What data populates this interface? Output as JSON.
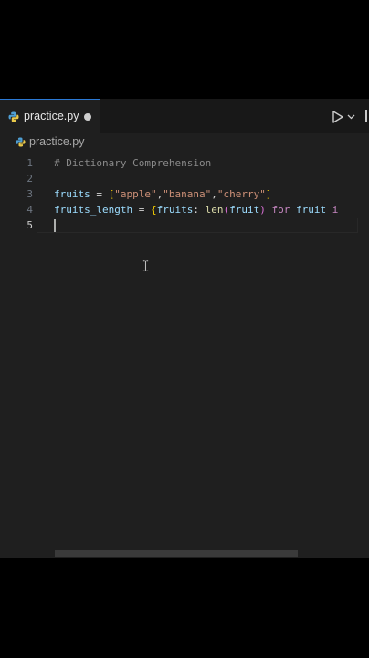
{
  "editor": {
    "tab": {
      "label": "practice.py",
      "modified": true
    },
    "breadcrumb": {
      "file": "practice.py"
    },
    "toolbar": {
      "run_icon": "play-icon",
      "dropdown_icon": "chevron-down-icon"
    },
    "lines": [
      {
        "number": "1",
        "text": "# Dictionary Comprehension"
      },
      {
        "number": "2",
        "text": ""
      },
      {
        "number": "3",
        "tokens": [
          "fruits",
          " = ",
          "[",
          "\"apple\"",
          ",",
          "\"banana\"",
          ",",
          "\"cherry\"",
          "]"
        ]
      },
      {
        "number": "4",
        "tokens": [
          "fruits_length",
          " = ",
          "{",
          "fruits",
          ": ",
          "len",
          "(",
          "fruit",
          ")",
          " ",
          "for",
          " ",
          "fruit",
          " ",
          "i"
        ]
      },
      {
        "number": "5",
        "text": ""
      }
    ],
    "active_line": 5
  },
  "colors": {
    "background": "#1f1f1f",
    "tab_bar": "#181818",
    "keyword": "#c586c0",
    "string": "#ce9178",
    "variable": "#9cdcfe",
    "function": "#dcdcaa",
    "comment": "#8a8a8a"
  }
}
